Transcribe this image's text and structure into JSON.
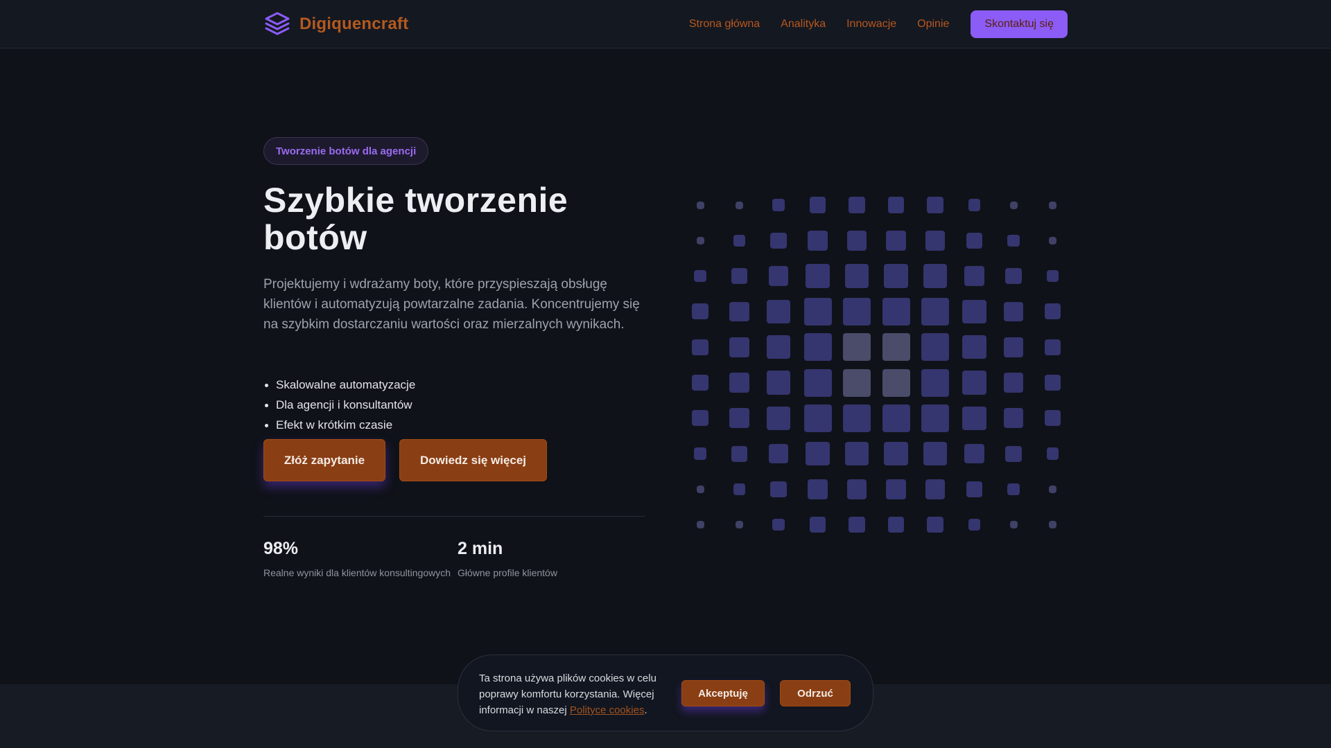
{
  "brand": {
    "name": "Digiquencraft",
    "logo_icon": "stack-layers-icon"
  },
  "nav": {
    "links": [
      "Strona główna",
      "Analityka",
      "Innowacje",
      "Opinie"
    ],
    "cta": "Skontaktuj się"
  },
  "hero": {
    "badge": "Tworzenie botów dla agencji",
    "title_line1": "Szybkie tworzenie",
    "title_line2": "botów",
    "description": "Projektujemy i wdrażamy boty, które przyspieszają obsługę klientów i automatyzują powtarzalne zadania. Koncentrujemy się na szybkim dostarczaniu wartości oraz mierzalnych wynikach.",
    "features": [
      "Skalowalne automatyzacje",
      "Dla agencji i konsultantów",
      "Efekt w krótkim czasie"
    ],
    "primary_button": "Złóż zapytanie",
    "secondary_button": "Dowiedz się więcej"
  },
  "stats": [
    {
      "value": "98%",
      "label": "Realne wyniki dla klientów konsultingowych"
    },
    {
      "value": "2 min",
      "label": "Główne profile klientów"
    }
  ],
  "cookie": {
    "text_before": "Ta strona używa plików cookies w celu poprawy komfortu korzystania. Więcej informacji w naszej ",
    "link": "Polityce cookies",
    "text_after": ".",
    "accept": "Akceptuję",
    "reject": "Odrzuć"
  },
  "colors": {
    "accent_purple": "#8b5cf6",
    "accent_orange": "#8a3e13",
    "brand_orange": "#b35a1f",
    "grid_blue": "#35356f",
    "grid_gray": "#4a4c6a"
  }
}
